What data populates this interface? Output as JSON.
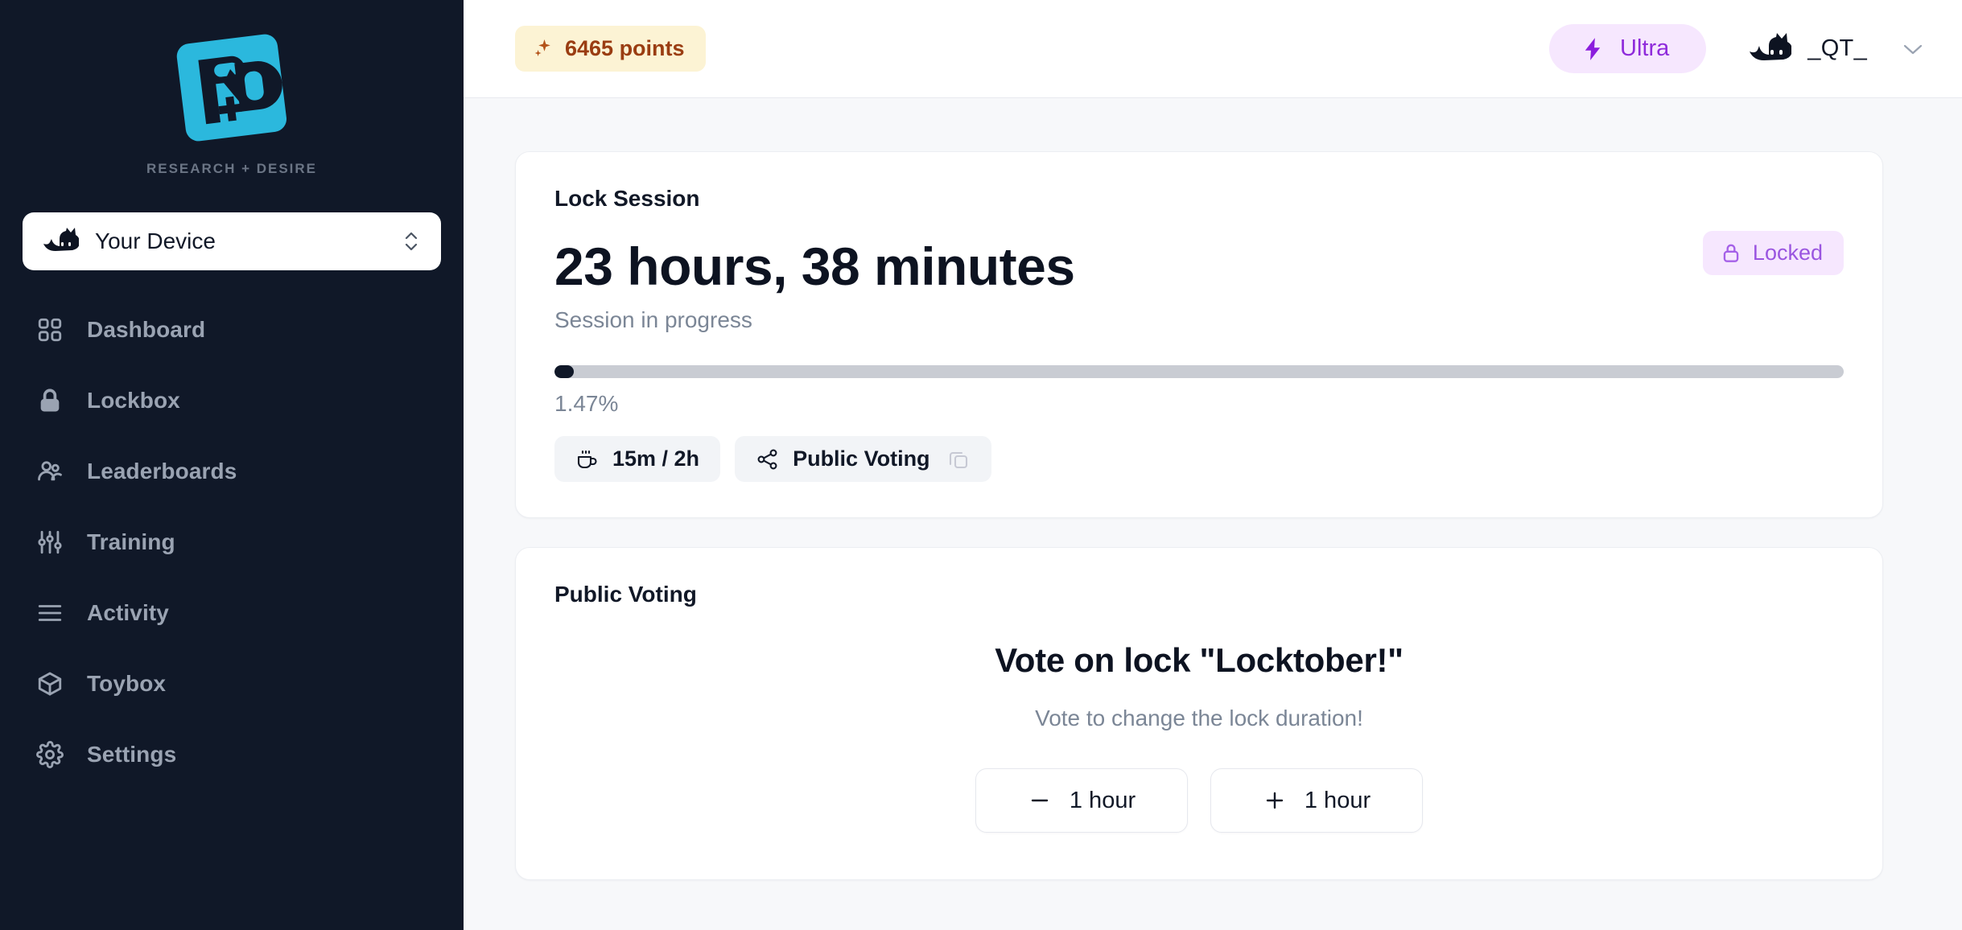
{
  "sidebar": {
    "brand": {
      "tagline": "RESEARCH + DESIRE",
      "logo_icon": "rd-logo-icon",
      "logo_color": "#2bb8dd"
    },
    "device_selector": {
      "icon": "cat-icon",
      "label": "Your Device",
      "chevron_icon": "chevron-up-down-icon"
    },
    "items": [
      {
        "label": "Dashboard",
        "icon": "grid-icon"
      },
      {
        "label": "Lockbox",
        "icon": "lock-icon"
      },
      {
        "label": "Leaderboards",
        "icon": "users-icon"
      },
      {
        "label": "Training",
        "icon": "sliders-icon"
      },
      {
        "label": "Activity",
        "icon": "menu-lines-icon"
      },
      {
        "label": "Toybox",
        "icon": "box-icon"
      },
      {
        "label": "Settings",
        "icon": "gear-icon"
      }
    ]
  },
  "topbar": {
    "points": {
      "icon": "sparkles-icon",
      "label": "6465 points",
      "bg_color": "#fcf3d4",
      "text_color": "#9a3d12"
    },
    "ultra": {
      "icon": "lightning-bolt-icon",
      "label": "Ultra",
      "bg_color": "#f6e7fe",
      "text_color": "#8f2bdb"
    },
    "account": {
      "avatar_icon": "cat-icon",
      "name": "_QT_",
      "caret_icon": "chevron-down-icon"
    }
  },
  "lock_session": {
    "title": "Lock Session",
    "duration": "23 hours, 38 minutes",
    "status": "Session in progress",
    "badge": {
      "label": "Locked",
      "icon": "lock-icon",
      "bg_color": "#f6e7fe",
      "text_color": "#9a55e0"
    },
    "progress": {
      "percent_label": "1.47%",
      "percent_value": 1.47,
      "track_color": "#c9ccd3",
      "fill_color": "#101828"
    },
    "chips": [
      {
        "label": "15m / 2h",
        "icon": "coffee-mug-icon",
        "trailing_icon": null
      },
      {
        "label": "Public Voting",
        "icon": "share-icon",
        "trailing_icon": "copy-icon"
      }
    ]
  },
  "public_voting": {
    "title": "Public Voting",
    "heading": "Vote on lock \"Locktober!\"",
    "subtitle": "Vote to change the lock duration!",
    "buttons": [
      {
        "label": "1 hour",
        "icon": "minus-icon"
      },
      {
        "label": "1 hour",
        "icon": "plus-icon"
      }
    ]
  }
}
